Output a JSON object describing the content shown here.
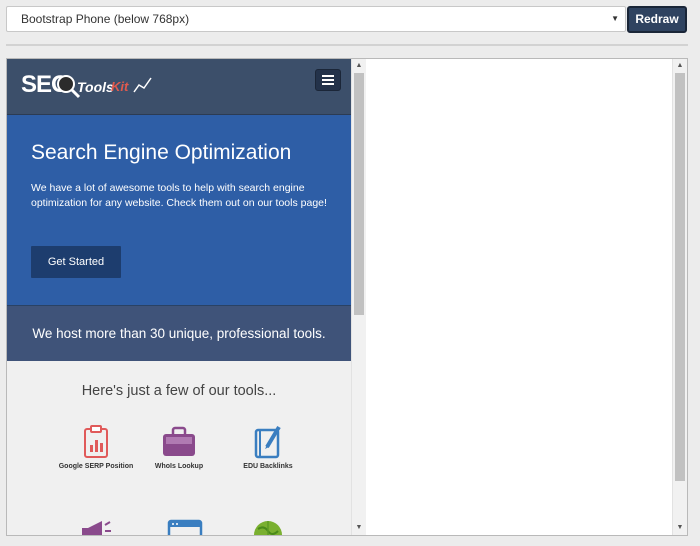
{
  "toolbar": {
    "device_select_value": "Bootstrap Phone (below 768px)",
    "redraw_label": "Redraw"
  },
  "site": {
    "logo": {
      "seo": "SEO",
      "tools": "Tools",
      "kit": "Kit"
    },
    "hero": {
      "title": "Search Engine Optimization",
      "text": "We have a lot of awesome tools to help with search engine optimization for any website. Check them out on our tools page!",
      "cta_label": "Get Started"
    },
    "host_text": "We host more than 30 unique, professional tools.",
    "tools_heading": "Here's just a few of our tools...",
    "tools": [
      {
        "label": "Google SERP Position",
        "icon": "clipboard-chart-icon"
      },
      {
        "label": "WhoIs Lookup",
        "icon": "briefcase-icon"
      },
      {
        "label": "EDU Backlinks",
        "icon": "notebook-pen-icon"
      },
      {
        "label": "",
        "icon": "megaphone-icon"
      },
      {
        "label": "",
        "icon": "browser-window-icon"
      },
      {
        "label": "",
        "icon": "globe-icon"
      }
    ]
  },
  "colors": {
    "nav": "#3c4f6a",
    "hero": "#2e5ea6",
    "host_band": "#3f5379",
    "cta": "#1d3d6e",
    "redraw": "#2f4360"
  }
}
